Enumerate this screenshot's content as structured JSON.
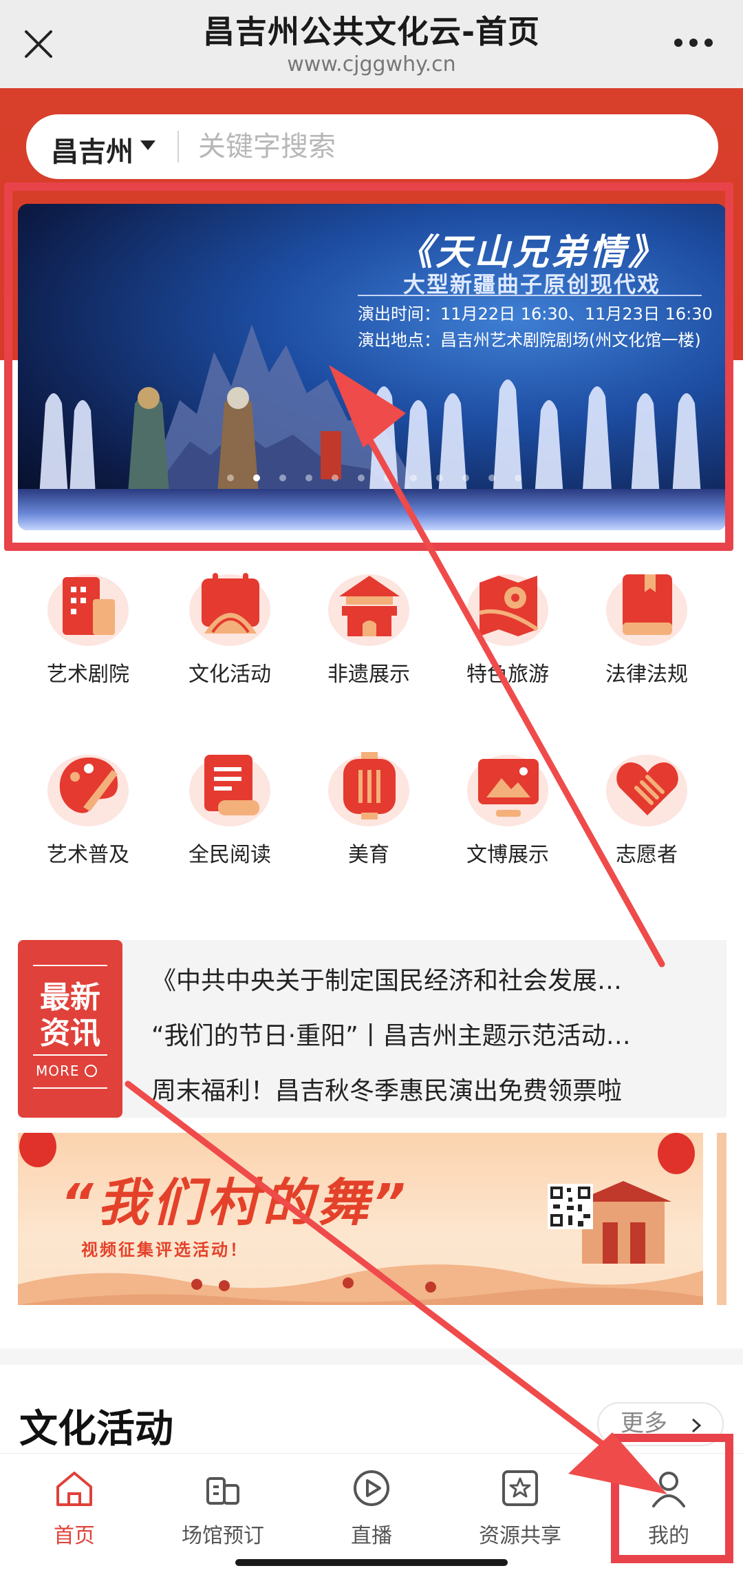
{
  "browser": {
    "title": "昌吉州公共文化云-首页",
    "url": "www.cjggwhy.cn",
    "close_icon": "close-icon",
    "more_icon": "more-dots-icon"
  },
  "search": {
    "city": "昌吉州",
    "placeholder": "关键字搜索"
  },
  "banner": {
    "title": "《天山兄弟情》",
    "subtitle": "大型新疆曲子原创现代戏",
    "time": "演出时间：11月22日 16:30、11月23日 16:30",
    "place": "演出地点：昌吉州艺术剧院剧场(州文化馆一楼)",
    "slide_count": 12,
    "active_slide": 1
  },
  "grid": [
    {
      "label": "艺术剧院",
      "icon": "theater-building-icon"
    },
    {
      "label": "文化活动",
      "icon": "calendar-fan-icon"
    },
    {
      "label": "非遗展示",
      "icon": "pavilion-icon"
    },
    {
      "label": "特色旅游",
      "icon": "map-pin-icon"
    },
    {
      "label": "法律法规",
      "icon": "law-book-icon"
    },
    {
      "label": "艺术普及",
      "icon": "palette-brush-icon"
    },
    {
      "label": "全民阅读",
      "icon": "scroll-document-icon"
    },
    {
      "label": "美育",
      "icon": "lantern-icon"
    },
    {
      "label": "文博展示",
      "icon": "picture-frame-icon"
    },
    {
      "label": "志愿者",
      "icon": "heart-hands-icon"
    }
  ],
  "news": {
    "badge_title": "最新资讯",
    "badge_more": "MORE",
    "items": [
      "《中共中央关于制定国民经济和社会发展…",
      "“我们的节日·重阳”丨昌吉州主题示范活动…",
      "周末福利！昌吉秋冬季惠民演出免费领票啦"
    ]
  },
  "promo": {
    "title": "“我们村的舞”",
    "subtitle": "视频征集评选活动！"
  },
  "section": {
    "title": "文化活动",
    "more": "更多"
  },
  "tabbar": [
    {
      "label": "首页",
      "icon": "home-icon",
      "active": true
    },
    {
      "label": "场馆预订",
      "icon": "venue-icon",
      "active": false
    },
    {
      "label": "直播",
      "icon": "play-icon",
      "active": false
    },
    {
      "label": "资源共享",
      "icon": "star-box-icon",
      "active": false
    },
    {
      "label": "我的",
      "icon": "user-icon",
      "active": false
    }
  ],
  "colors": {
    "brand_red": "#d8402c",
    "annotation_red": "#e8434a",
    "tab_active": "#e0413a"
  }
}
